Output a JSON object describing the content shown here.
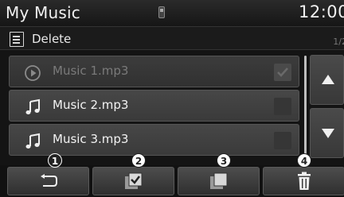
{
  "status": {
    "title": "My Music",
    "usb_icon": "usb-icon",
    "clock": "12:00"
  },
  "subheader": {
    "menu_icon": "list-menu-icon",
    "label": "Delete",
    "page": "1/2"
  },
  "list": {
    "items": [
      {
        "icon": "play-circle-icon",
        "label": "Music 1.mp3",
        "checked": true,
        "dimmed": true
      },
      {
        "icon": "music-note-icon",
        "label": "Music 2.mp3",
        "checked": false,
        "dimmed": false
      },
      {
        "icon": "music-note-icon",
        "label": "Music 3.mp3",
        "checked": false,
        "dimmed": false
      }
    ]
  },
  "scroll": {
    "up_icon": "arrow-up-icon",
    "down_icon": "arrow-down-icon"
  },
  "toolbar": {
    "buttons": [
      {
        "icon": "back-icon",
        "callout": "1"
      },
      {
        "icon": "mark-all-icon",
        "callout": "2"
      },
      {
        "icon": "unmark-all-icon",
        "callout": "3"
      },
      {
        "icon": "trash-icon",
        "callout": "4"
      }
    ]
  },
  "colors": {
    "screen_bg": "#141414",
    "row_bg": "#474747",
    "text": "#f2f2f2",
    "dim_text": "#7a7a7a"
  }
}
